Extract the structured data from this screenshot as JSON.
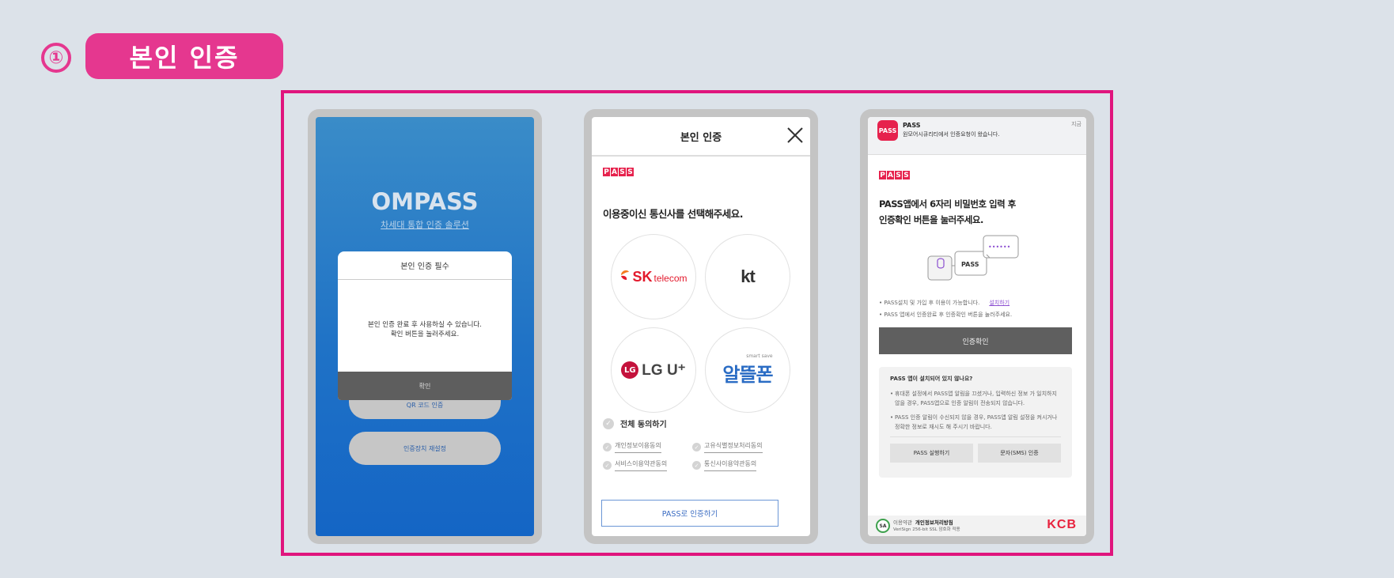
{
  "step": {
    "number": "①",
    "title": "본인 인증"
  },
  "phone1": {
    "logo": "OMPASS",
    "sublogo": "차세대 통합 인증 솔루션",
    "modal_title": "본인 인증 필수",
    "modal_line1": "본인 인증 완료 후 사용하실 수 있습니다.",
    "modal_line2": "확인 버튼을 눌러주세요.",
    "modal_button": "확인",
    "qr_button": "QR 코드 인증",
    "reset_button": "인증장치 재설정"
  },
  "phone2": {
    "header_title": "본인 인증",
    "pass_logo": [
      "P",
      "A",
      "S",
      "S"
    ],
    "prompt": "이용중이신 통신사를 선택해주세요.",
    "carriers": {
      "sk_brand": "SK",
      "sk_sub": "telecom",
      "kt": "kt",
      "lg_circle": "LG",
      "lg_text": "LG U⁺",
      "al_small": "smart save",
      "al_text": "알뜰폰"
    },
    "agree_all": "전체 동의하기",
    "terms": [
      "개인정보이용동의",
      "고유식별정보처리동의",
      "서비스이용약관동의",
      "통신사이용약관동의"
    ],
    "pass_button": "PASS로 인증하기"
  },
  "phone3": {
    "notif_icon": "PASS",
    "notif_app": "PASS",
    "notif_msg": "원모어시큐리티에서 인증요청이 왔습니다.",
    "notif_time": "지금",
    "pass_logo": [
      "P",
      "A",
      "S",
      "S"
    ],
    "instruction_line1": "PASS앱에서 6자리 비밀번호 입력 후",
    "instruction_line2": "인증확인 버튼을 눌러주세요.",
    "illu_pass": "PASS",
    "illu_dots": "••••••",
    "bullet1": "PASS설치 및 가입 후 이용이 가능합니다.",
    "bullet1_link": "설치하기",
    "bullet2": "PASS 앱에서 인증완료 후 인증확인 버튼을 눌러주세요.",
    "confirm_button": "인증확인",
    "faq_question": "PASS 앱이 설치되어 있지 않나요?",
    "faq_item1": "휴대폰 설정에서 PASS앱 알림을 끄셨거나, 입력하신 정보 가 일치하지 않을 경우, PASS앱으로 인증 알림이 전송되지 않습니다.",
    "faq_item2": "PASS 인증 알림이 수신되지 않을 경우, PASS앱 알림 설정을 켜시거나 정확한 정보로 재시도 해 주시기 바랍니다.",
    "faq_btn1": "PASS 실행하기",
    "faq_btn2": "문자(SMS) 인증",
    "footer_seal": "SA",
    "footer_terms": "이용약관",
    "footer_privacy": "개인정보처리방침",
    "footer_ssl": "VeriSign 256-bit SSL 암호화 적용",
    "footer_brand": "KCB"
  }
}
